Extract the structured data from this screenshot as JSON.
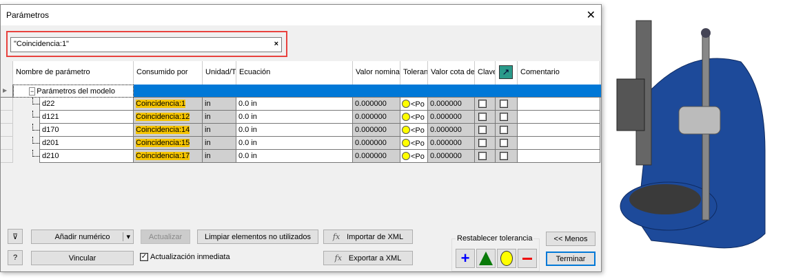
{
  "title": "Parámetros",
  "search": {
    "value": "\"Coincidencia:1\"",
    "clear": "×"
  },
  "columns": [
    "Nombre de parámetro",
    "Consumido por",
    "Unidad/T",
    "Ecuación",
    "Valor nominal",
    "Tolerancia",
    "Valor cota de",
    "Clave",
    "",
    "Comentario"
  ],
  "group": {
    "toggle": "−",
    "label": "Parámetros del modelo"
  },
  "rows": [
    {
      "name": "d22",
      "consumed": "Coincidencia:1",
      "unit": "in",
      "equation": "0.0 in",
      "nominal": "0.000000",
      "tolerance": "<Po",
      "value": "0.000000"
    },
    {
      "name": "d121",
      "consumed": "Coincidencia:12",
      "unit": "in",
      "equation": "0.0 in",
      "nominal": "0.000000",
      "tolerance": "<Po",
      "value": "0.000000"
    },
    {
      "name": "d170",
      "consumed": "Coincidencia:14",
      "unit": "in",
      "equation": "0.0 in",
      "nominal": "0.000000",
      "tolerance": "<Po",
      "value": "0.000000"
    },
    {
      "name": "d201",
      "consumed": "Coincidencia:15",
      "unit": "in",
      "equation": "0.0 in",
      "nominal": "0.000000",
      "tolerance": "<Po",
      "value": "0.000000"
    },
    {
      "name": "d210",
      "consumed": "Coincidencia:17",
      "unit": "in",
      "equation": "0.0 in",
      "nominal": "0.000000",
      "tolerance": "<Po",
      "value": "0.000000"
    }
  ],
  "buttons": {
    "add_numeric": "Añadir numérico",
    "update": "Actualizar",
    "purge": "Limpiar elementos no utilizados",
    "import_xml": "Importar de XML",
    "link": "Vincular",
    "immediate_update": "Actualización inmediata",
    "export_xml": "Exportar a XML",
    "less": "<< Menos",
    "finish": "Terminar"
  },
  "tolerance_reset": {
    "label": "Restablecer tolerancia"
  },
  "colors": {
    "selection": "#0078d7",
    "highlight": "#f5c400",
    "highlight_box": "#e8413d",
    "model": "#1d4a9a"
  }
}
